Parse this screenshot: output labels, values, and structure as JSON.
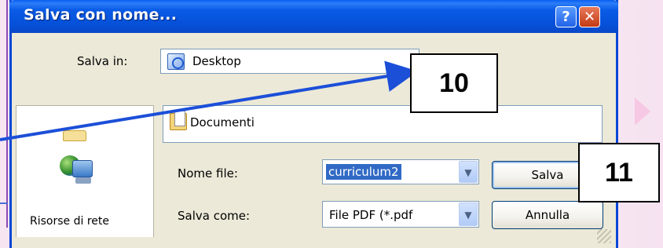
{
  "dialog": {
    "title": "Salva con nome...",
    "help_glyph": "?",
    "close_glyph": "✕"
  },
  "save_in": {
    "label": "Salva in:",
    "value": "Desktop",
    "icon": "desktop-icon"
  },
  "places_bar": {
    "items": [
      {
        "icon": "folder-icon",
        "label": ""
      },
      {
        "icon": "network-icon",
        "label": "Risorse di rete"
      }
    ]
  },
  "file_list": {
    "items": [
      {
        "icon": "documents-folder-icon",
        "label": "Documenti"
      }
    ]
  },
  "filename": {
    "label": "Nome file:",
    "value": "curriculum2",
    "dropdown_glyph": "▼"
  },
  "filetype": {
    "label": "Salva come:",
    "value": "File PDF (*.pdf",
    "dropdown_glyph": "▼"
  },
  "buttons": {
    "save": "Salva",
    "cancel": "Annulla"
  },
  "callouts": {
    "first": "10",
    "second": "11"
  },
  "colors": {
    "titlebar": "#0a5be6",
    "dialog_bg": "#ece9d8",
    "selection": "#316ac5",
    "pointer_line": "#1c4fd8"
  }
}
